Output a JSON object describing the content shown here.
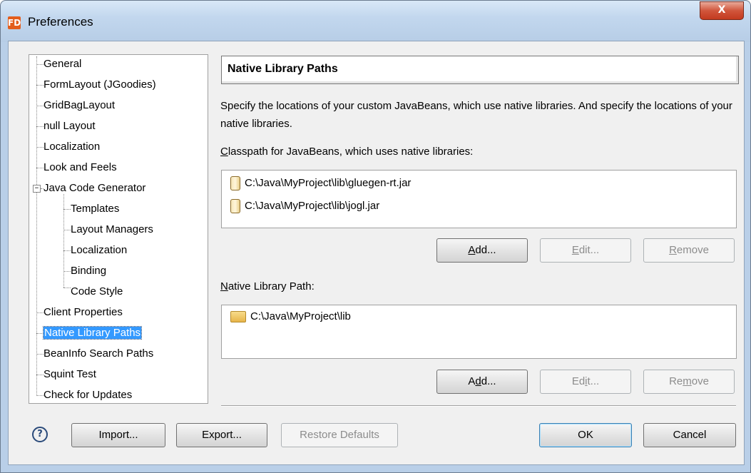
{
  "window": {
    "title": "Preferences",
    "app_icon": "FD",
    "close_glyph": "X"
  },
  "tree": {
    "items": [
      {
        "label": "General"
      },
      {
        "label": "FormLayout (JGoodies)"
      },
      {
        "label": "GridBagLayout"
      },
      {
        "label": "null Layout"
      },
      {
        "label": "Localization"
      },
      {
        "label": "Look and Feels"
      },
      {
        "label": "Java Code Generator",
        "expanded": true,
        "children": [
          {
            "label": "Templates"
          },
          {
            "label": "Layout Managers"
          },
          {
            "label": "Localization"
          },
          {
            "label": "Binding"
          },
          {
            "label": "Code Style"
          }
        ]
      },
      {
        "label": "Client Properties"
      },
      {
        "label": "Native Library Paths",
        "selected": true
      },
      {
        "label": "BeanInfo Search Paths"
      },
      {
        "label": "Squint Test"
      },
      {
        "label": "Check for Updates"
      }
    ],
    "expander_glyph": "−"
  },
  "panel": {
    "title": "Native Library Paths",
    "description": "Specify the locations of your custom JavaBeans, which use native libraries. And specify the locations of your native libraries.",
    "classpath_label": {
      "mnemonic": "C",
      "rest": "lasspath for JavaBeans, which uses native libraries:"
    },
    "classpath_entries": [
      "C:\\Java\\MyProject\\lib\\gluegen-rt.jar",
      "C:\\Java\\MyProject\\lib\\jogl.jar"
    ],
    "native_label": {
      "mnemonic": "N",
      "rest": "ative Library Path:"
    },
    "native_entries": [
      "C:\\Java\\MyProject\\lib"
    ],
    "buttons1": {
      "add_pre": "",
      "add_mn": "A",
      "add_post": "dd...",
      "edit_pre": "",
      "edit_mn": "E",
      "edit_post": "dit...",
      "remove_pre": "",
      "remove_mn": "R",
      "remove_post": "emove"
    },
    "buttons2": {
      "add_pre": "A",
      "add_mn": "d",
      "add_post": "d...",
      "edit_pre": "Ed",
      "edit_mn": "i",
      "edit_post": "t...",
      "remove_pre": "Re",
      "remove_mn": "m",
      "remove_post": "ove"
    }
  },
  "footer": {
    "help_glyph": "?",
    "import": "Import...",
    "export": "Export...",
    "restore": "Restore Defaults",
    "ok": "OK",
    "cancel": "Cancel"
  }
}
